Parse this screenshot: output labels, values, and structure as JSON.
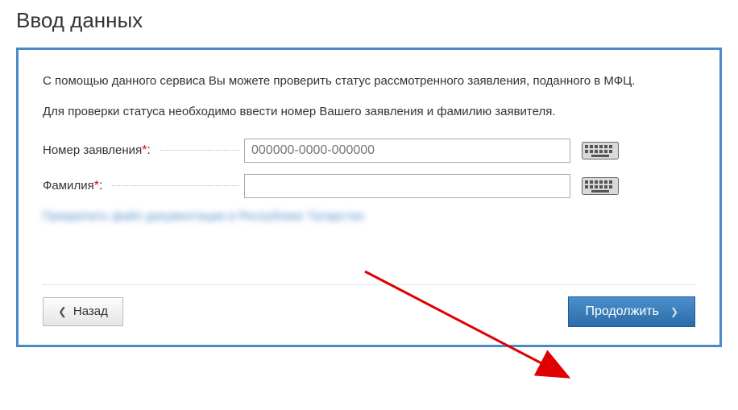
{
  "page": {
    "title": "Ввод данных",
    "intro1": "С помощью данного сервиса Вы можете проверить статус рассмотренного заявления, поданного в МФЦ.",
    "intro2": "Для проверки статуса необходимо ввести номер Вашего заявления и фамилию заявителя."
  },
  "form": {
    "application_number": {
      "label": "Номер заявления",
      "required_mark": "*",
      "colon": ":",
      "placeholder": "000000-0000-000000",
      "value": ""
    },
    "surname": {
      "label": "Фамилия",
      "required_mark": "*",
      "colon": ":",
      "placeholder": "",
      "value": ""
    },
    "blurred_link_text": "Прикрепить файл документации в Республике Татарстан"
  },
  "buttons": {
    "back": "Назад",
    "next": "Продолжить"
  }
}
